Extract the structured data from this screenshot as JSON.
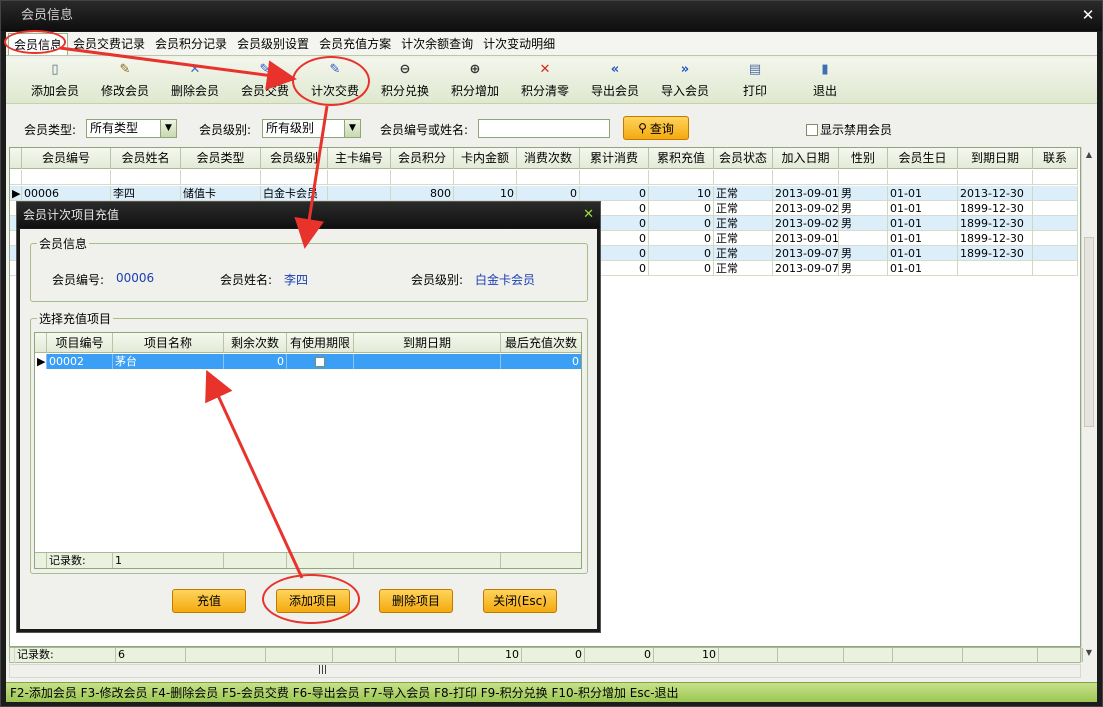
{
  "window": {
    "title": "会员信息",
    "close": "✕"
  },
  "tabs": [
    "会员信息",
    "会员交费记录",
    "会员积分记录",
    "会员级别设置",
    "会员充值方案",
    "计次余额查询",
    "计次变动明细"
  ],
  "toolbar": [
    {
      "label": "添加会员",
      "icon": "add-member-icon",
      "glyph": "▯",
      "color": "#5a6e8a"
    },
    {
      "label": "修改会员",
      "icon": "edit-member-icon",
      "glyph": "✎",
      "color": "#8a6a20"
    },
    {
      "label": "删除会员",
      "icon": "delete-member-icon",
      "glyph": "✕",
      "color": "#3b6ec7"
    },
    {
      "label": "会员交费",
      "icon": "pay-pen-icon",
      "glyph": "✎",
      "color": "#2b58c4"
    },
    {
      "label": "计次交费",
      "icon": "count-pay-pen-icon",
      "glyph": "✎",
      "color": "#2b58c4"
    },
    {
      "label": "积分兑换",
      "icon": "zoom-out-icon",
      "glyph": "⊖",
      "color": "#333333"
    },
    {
      "label": "积分增加",
      "icon": "zoom-in-icon",
      "glyph": "⊕",
      "color": "#333333"
    },
    {
      "label": "积分清零",
      "icon": "clear-icon",
      "glyph": "✕",
      "color": "#d42a1c"
    },
    {
      "label": "导出会员",
      "icon": "export-icon",
      "glyph": "«",
      "color": "#1f54c9"
    },
    {
      "label": "导入会员",
      "icon": "import-icon",
      "glyph": "»",
      "color": "#1f54c9"
    },
    {
      "label": "打印",
      "icon": "printer-icon",
      "glyph": "▤",
      "color": "#4a6da8"
    },
    {
      "label": "退出",
      "icon": "exit-door-icon",
      "glyph": "▮",
      "color": "#3e6fb0"
    }
  ],
  "filter": {
    "type_label": "会员类型:",
    "type_value": "所有类型",
    "level_label": "会员级别:",
    "level_value": "所有级别",
    "search_label": "会员编号或姓名:",
    "search_value": "",
    "query_label": "查询",
    "disabled_label": "显示禁用会员"
  },
  "grid": {
    "columns": [
      "会员编号",
      "会员姓名",
      "会员类型",
      "会员级别",
      "主卡编号",
      "会员积分",
      "卡内金额",
      "消费次数",
      "累计消费",
      "累积充值",
      "会员状态",
      "加入日期",
      "性别",
      "会员生日",
      "到期日期",
      "联系"
    ],
    "rows": [
      [
        "00006",
        "李四",
        "储值卡",
        "白金卡会员",
        "",
        "800",
        "10",
        "0",
        "0",
        "10",
        "正常",
        "2013-09-01",
        "男",
        "01-01",
        "2013-12-30",
        ""
      ],
      [
        "",
        "",
        "",
        "",
        "",
        "",
        "",
        "",
        "0",
        "0",
        "正常",
        "2013-09-02",
        "男",
        "01-01",
        "1899-12-30",
        ""
      ],
      [
        "",
        "",
        "",
        "",
        "",
        "",
        "",
        "",
        "0",
        "0",
        "正常",
        "2013-09-02",
        "男",
        "01-01",
        "1899-12-30",
        ""
      ],
      [
        "",
        "",
        "",
        "",
        "",
        "",
        "",
        "",
        "0",
        "0",
        "正常",
        "2013-09-01",
        "",
        "01-01",
        "1899-12-30",
        ""
      ],
      [
        "",
        "",
        "",
        "",
        "",
        "",
        "",
        "",
        "0",
        "0",
        "正常",
        "2013-09-07",
        "男",
        "01-01",
        "1899-12-30",
        ""
      ],
      [
        "",
        "",
        "",
        "",
        "",
        "",
        "",
        "",
        "0",
        "0",
        "正常",
        "2013-09-07",
        "男",
        "01-01",
        "",
        ""
      ]
    ],
    "footer": [
      "记录数:",
      "6",
      "",
      "",
      "",
      "",
      "10",
      "0",
      "0",
      "10",
      "",
      "",
      "",
      "",
      "",
      ""
    ]
  },
  "hscroll_grip": "|||",
  "statusbar": "F2-添加会员 F3-修改会员 F4-删除会员 F5-会员交费 F6-导出会员 F7-导入会员 F8-打印 F9-积分兑换 F10-积分增加 Esc-退出",
  "dialog": {
    "title": "会员计次项目充值",
    "close": "✕",
    "info_group": "会员信息",
    "member_no_label": "会员编号:",
    "member_no": "00006",
    "member_name_label": "会员姓名:",
    "member_name": "李四",
    "member_level_label": "会员级别:",
    "member_level": "白金卡会员",
    "items_group": "选择充值项目",
    "columns": [
      "项目编号",
      "项目名称",
      "剩余次数",
      "有使用期限",
      "到期日期",
      "最后充值次数"
    ],
    "row": {
      "no": "00002",
      "name": "茅台",
      "remain": "0",
      "expire": "",
      "last": "0"
    },
    "footer_label": "记录数:",
    "footer_count": "1",
    "buttons": {
      "recharge": "充值",
      "add": "添加项目",
      "delete": "删除项目",
      "close": "关闭(Esc)"
    }
  },
  "colors": {
    "accent_green": "#9cc653",
    "button_orange": "#f4a90f",
    "selection_blue": "#3b9ff5",
    "annotation_red": "#e8322c",
    "value_blue": "#1a3fb3"
  }
}
